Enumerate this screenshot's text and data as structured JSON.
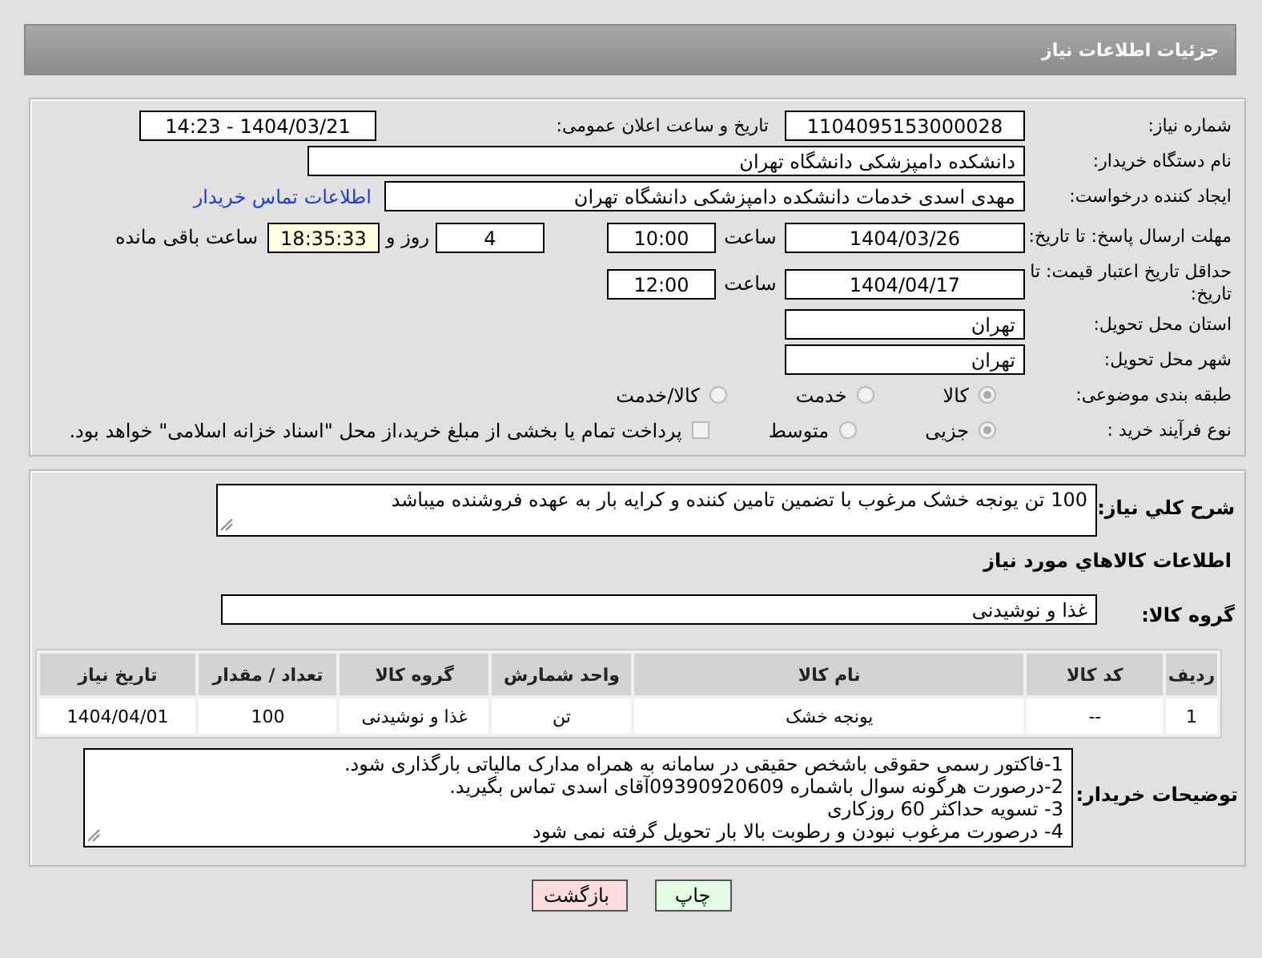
{
  "header": {
    "title": "جزئیات اطلاعات نیاز"
  },
  "need_number": {
    "label": "شماره نیاز:",
    "value": "1104095153000028"
  },
  "announce": {
    "label": "تاریخ و ساعت اعلان عمومی:",
    "value": "1404/03/21 - 14:23"
  },
  "buyer_org": {
    "label": "نام دستگاه خریدار:",
    "value": "دانشکده دامپزشکی دانشگاه تهران"
  },
  "requester": {
    "label": "ایجاد کننده درخواست:",
    "value": "مهدی اسدی خدمات دانشکده دامپزشکی دانشگاه تهران",
    "link": "اطلاعات تماس خریدار"
  },
  "deadline": {
    "label": "مهلت ارسال پاسخ: تا تاریخ:",
    "date": "1404/03/26",
    "time_label": "ساعت",
    "time": "10:00",
    "days": "4",
    "days_label": "روز و",
    "remaining": "18:35:33",
    "remaining_label": "ساعت باقی مانده"
  },
  "price_validity": {
    "label": "حداقل تاریخ اعتبار قیمت: تا تاریخ:",
    "date": "1404/04/17",
    "time_label": "ساعت",
    "time": "12:00"
  },
  "province": {
    "label": "استان محل تحویل:",
    "value": "تهران"
  },
  "city": {
    "label": "شهر محل تحویل:",
    "value": "تهران"
  },
  "category": {
    "label": "طبقه بندی موضوعی:",
    "options": [
      {
        "label": "کالا",
        "selected": true
      },
      {
        "label": "خدمت",
        "selected": false
      },
      {
        "label": "کالا/خدمت",
        "selected": false
      }
    ]
  },
  "process": {
    "label": "نوع فرآیند خرید :",
    "options": [
      {
        "label": "جزیی",
        "selected": true
      },
      {
        "label": "متوسط",
        "selected": false
      }
    ],
    "treasury": {
      "label": "پرداخت تمام یا بخشی از مبلغ خرید،از محل \"اسناد خزانه اسلامی\" خواهد بود.",
      "checked": false
    }
  },
  "description": {
    "label": "شرح کلي نياز:",
    "value": "100 تن یونجه خشک مرغوب با تضمین تامین کننده و کرایه بار به عهده فروشنده میباشد"
  },
  "goods_title": "اطلاعات کالاهاي مورد نياز",
  "goods_group": {
    "label": "گروه کالا:",
    "value": "غذا و نوشیدنی"
  },
  "table": {
    "columns": [
      "ردیف",
      "کد کالا",
      "نام کالا",
      "واحد شمارش",
      "گروه کالا",
      "تعداد / مقدار",
      "تاریخ نیاز"
    ],
    "rows": [
      [
        "1",
        "--",
        "یونجه خشک",
        "تن",
        "غذا و نوشیدنی",
        "100",
        "1404/04/01"
      ]
    ]
  },
  "buyer_notes": {
    "label": "توضیحات خریدار:",
    "lines": [
      "1-فاکتور رسمی حقوقی باشخص حقیقی در سامانه به همراه مدارک مالیاتی بارگذاری شود.",
      "2-درصورت هرگونه سوال باشماره 09390920609آقای اسدی تماس بگیرید.",
      "3- تسویه حداکثر 60 روزکاری",
      "4- درصورت مرغوب نبودن و رطوبت بالا بار تحویل گرفته نمی شود"
    ]
  },
  "buttons": [
    {
      "label": "چاپ",
      "kind": "print"
    },
    {
      "label": "بازگشت",
      "kind": "back"
    }
  ]
}
